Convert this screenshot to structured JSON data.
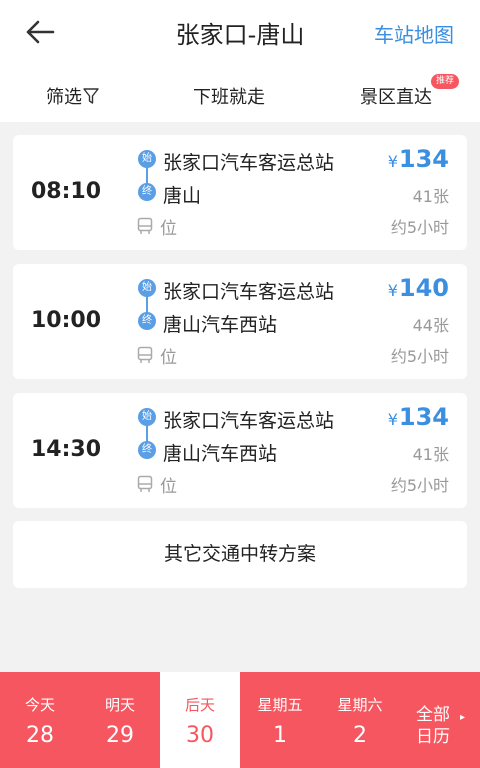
{
  "header": {
    "title": "张家口-唐山",
    "map_link": "车站地图",
    "back_icon": "arrow-left-icon"
  },
  "filters": {
    "filter_label": "筛选",
    "filter_icon": "funnel-icon",
    "after_work": "下班就走",
    "scenic": "景区直达",
    "scenic_badge": "推荐"
  },
  "trips": [
    {
      "time": "08:10",
      "start_tag": "始",
      "start": "张家口汽车客运总站",
      "end_tag": "终",
      "end": "唐山",
      "seat_label": "位",
      "currency": "¥",
      "price": "134",
      "tickets": "41张",
      "duration": "约5小时"
    },
    {
      "time": "10:00",
      "start_tag": "始",
      "start": "张家口汽车客运总站",
      "end_tag": "终",
      "end": "唐山汽车西站",
      "seat_label": "位",
      "currency": "¥",
      "price": "140",
      "tickets": "44张",
      "duration": "约5小时"
    },
    {
      "time": "14:30",
      "start_tag": "始",
      "start": "张家口汽车客运总站",
      "end_tag": "终",
      "end": "唐山汽车西站",
      "seat_label": "位",
      "currency": "¥",
      "price": "134",
      "tickets": "41张",
      "duration": "约5小时"
    }
  ],
  "transfer": "其它交通中转方案",
  "dates": [
    {
      "name": "今天",
      "date": "28"
    },
    {
      "name": "明天",
      "date": "29"
    },
    {
      "name": "后天",
      "date": "30"
    },
    {
      "name": "星期五",
      "date": "1"
    },
    {
      "name": "星期六",
      "date": "2"
    }
  ],
  "selected_date_index": 2,
  "calendar": {
    "line1": "全部",
    "line2": "日历"
  },
  "colors": {
    "accent_blue": "#3a8fe0",
    "accent_red": "#f5565f",
    "background": "#f2f2f2"
  }
}
